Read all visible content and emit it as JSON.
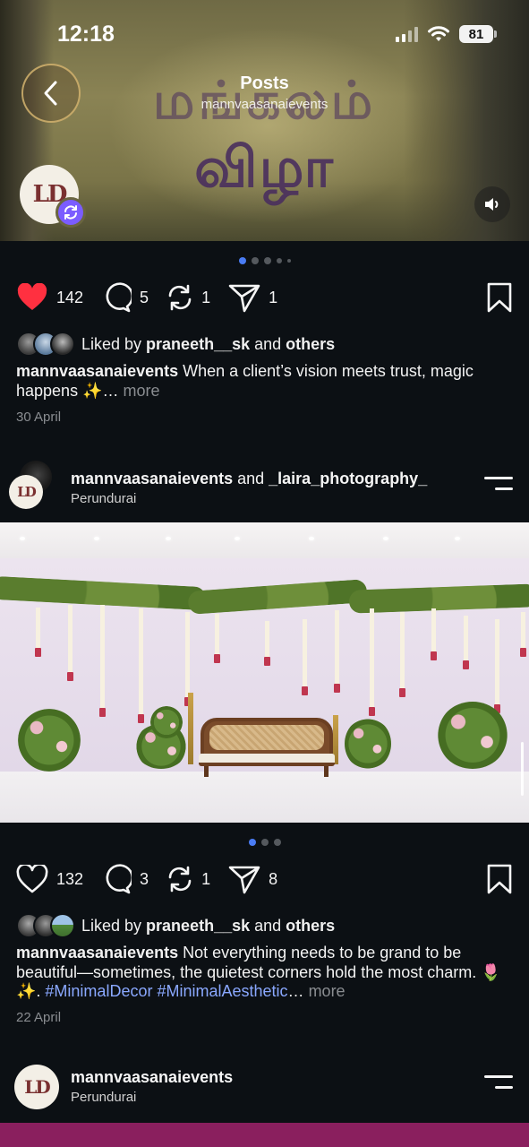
{
  "status_bar": {
    "time": "12:18",
    "battery": "81"
  },
  "header": {
    "title": "Posts",
    "subtitle": "mannvaasanaievents"
  },
  "post1": {
    "media_text": [
      "மங்கலம்",
      "விழா"
    ],
    "likes": "142",
    "comments": "5",
    "reposts": "1",
    "shares": "1",
    "liked_by_prefix": "Liked by ",
    "liked_by_user": "praneeth__sk",
    "liked_by_and": " and ",
    "liked_by_others": "others",
    "caption_user": "mannvaasanaievents",
    "caption_text": " When a client’s vision meets trust, magic happens ✨… ",
    "more": "more",
    "date": "30 April"
  },
  "post2": {
    "author": "mannvaasanaievents",
    "and_text": " and ",
    "collaborator": "_laira_photography_",
    "location": "Perundurai",
    "likes": "132",
    "comments": "3",
    "reposts": "1",
    "shares": "8",
    "liked_by_prefix": "Liked by ",
    "liked_by_user": "praneeth__sk",
    "liked_by_and": " and ",
    "liked_by_others": "others",
    "caption_user": "mannvaasanaievents",
    "caption_text": " Not everything needs to be grand to be beautiful—sometimes, the quietest corners hold the most charm. 🌷✨. ",
    "hashtag1": "#MinimalDecor",
    "hashtag2": "#MinimalAesthetic",
    "ellipsis": "… ",
    "more": "more",
    "date": "22 April"
  },
  "post3": {
    "author": "mannvaasanaievents",
    "location": "Perundurai"
  },
  "logo_text": "LD",
  "colors": {
    "background": "#0c1014",
    "like_red": "#ff3040",
    "dot_active": "#4a7cf4",
    "repost_badge": "#7b5cff",
    "link": "#8aa8ff"
  },
  "icons": [
    "back-chevron-icon",
    "repost-icon",
    "sound-icon",
    "heart-icon",
    "comment-icon",
    "repost-icon",
    "share-icon",
    "bookmark-icon",
    "menu-icon"
  ]
}
